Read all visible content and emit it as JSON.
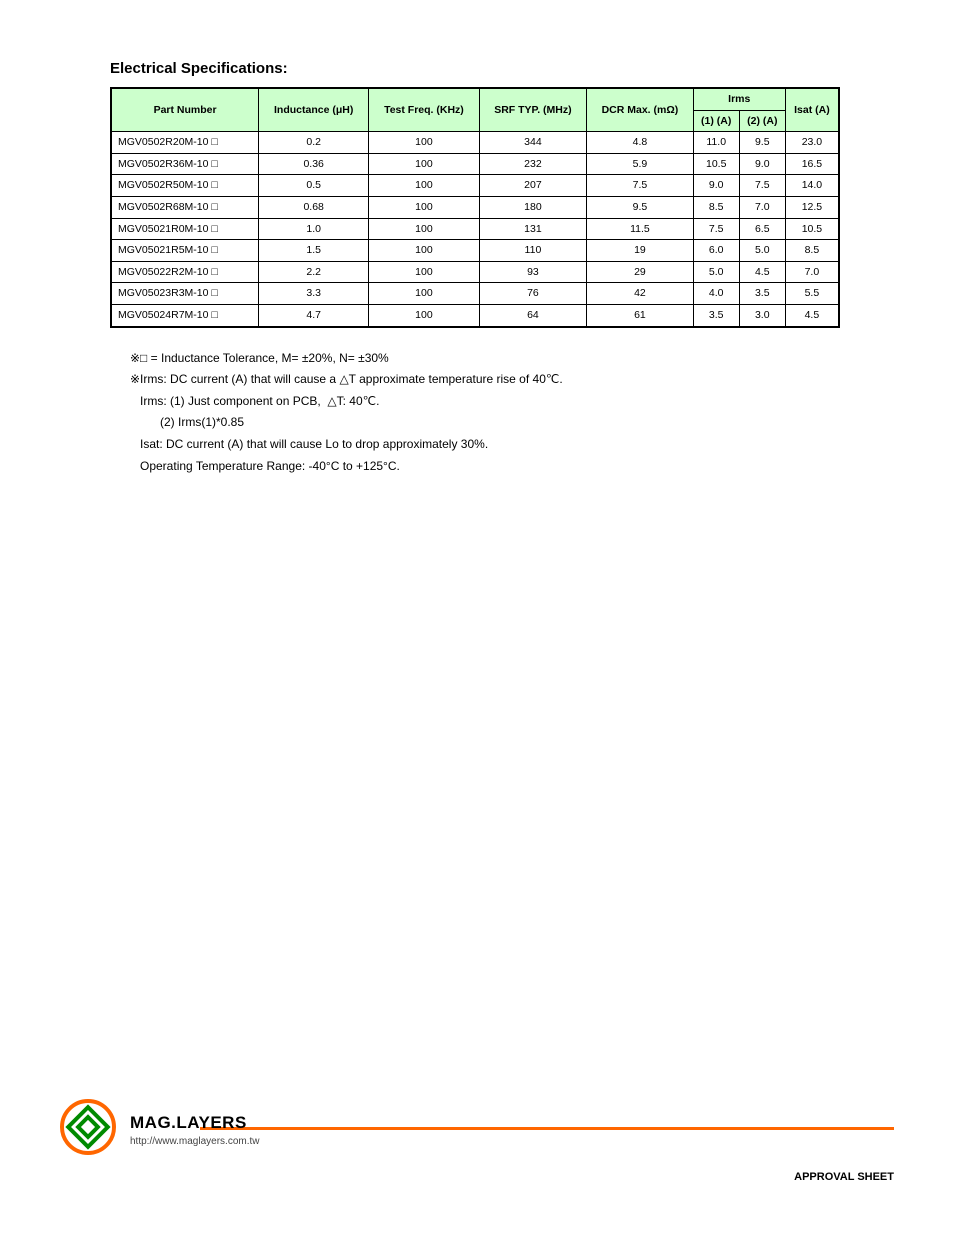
{
  "section_title": "Electrical Specifications:",
  "headers": {
    "part": "Part Number",
    "inductance": "Inductance (μH)",
    "testfreq": "Test Freq. (KHz)",
    "srf": "SRF TYP. (MHz)",
    "dcr": "DCR Max. (mΩ)",
    "irms_group": "Irms",
    "irms1": "(1) (A)",
    "irms2": "(2) (A)",
    "isat": "Isat (A)"
  },
  "rows": [
    {
      "part": "MGV0502R20M-10 □",
      "l": "0.2",
      "f": "100",
      "srf": "344",
      "dcr": "4.8",
      "i1": "11.0",
      "i2": "9.5",
      "isat": "23.0"
    },
    {
      "part": "MGV0502R36M-10 □",
      "l": "0.36",
      "f": "100",
      "srf": "232",
      "dcr": "5.9",
      "i1": "10.5",
      "i2": "9.0",
      "isat": "16.5"
    },
    {
      "part": "MGV0502R50M-10 □",
      "l": "0.5",
      "f": "100",
      "srf": "207",
      "dcr": "7.5",
      "i1": "9.0",
      "i2": "7.5",
      "isat": "14.0"
    },
    {
      "part": "MGV0502R68M-10 □",
      "l": "0.68",
      "f": "100",
      "srf": "180",
      "dcr": "9.5",
      "i1": "8.5",
      "i2": "7.0",
      "isat": "12.5"
    },
    {
      "part": "MGV05021R0M-10 □",
      "l": "1.0",
      "f": "100",
      "srf": "131",
      "dcr": "11.5",
      "i1": "7.5",
      "i2": "6.5",
      "isat": "10.5"
    },
    {
      "part": "MGV05021R5M-10 □",
      "l": "1.5",
      "f": "100",
      "srf": "110",
      "dcr": "19",
      "i1": "6.0",
      "i2": "5.0",
      "isat": "8.5"
    },
    {
      "part": "MGV05022R2M-10 □",
      "l": "2.2",
      "f": "100",
      "srf": "93",
      "dcr": "29",
      "i1": "5.0",
      "i2": "4.5",
      "isat": "7.0"
    },
    {
      "part": "MGV05023R3M-10 □",
      "l": "3.3",
      "f": "100",
      "srf": "76",
      "dcr": "42",
      "i1": "4.0",
      "i2": "3.5",
      "isat": "5.5"
    },
    {
      "part": "MGV05024R7M-10 □",
      "l": "4.7",
      "f": "100",
      "srf": "64",
      "dcr": "61",
      "i1": "3.5",
      "i2": "3.0",
      "isat": "4.5"
    }
  ],
  "notes": {
    "n1_a": "※□ = Inductance Tolerance, M= ±20%, N= ±30%",
    "n2_a": "※Irms: DC current (A) that will cause a ",
    "n2_b": "△T approximate temperature rise of 40℃.",
    "n3_a": "   Irms: (1) Just component on PCB,  ",
    "n3_b": "△T: 40℃.",
    "n4_a": "         (2) Irms(1)*0.85",
    "n5_a": "   Isat: DC current (A) that will cause Lo to drop approximately 30%.",
    "n6_a": "   Operating Temperature Range: -40°C to +125°C."
  },
  "footer": {
    "company": "MAG.LAYERS",
    "web": "http://www.maglayers.com.tw",
    "approval": "APPROVAL SHEET"
  }
}
